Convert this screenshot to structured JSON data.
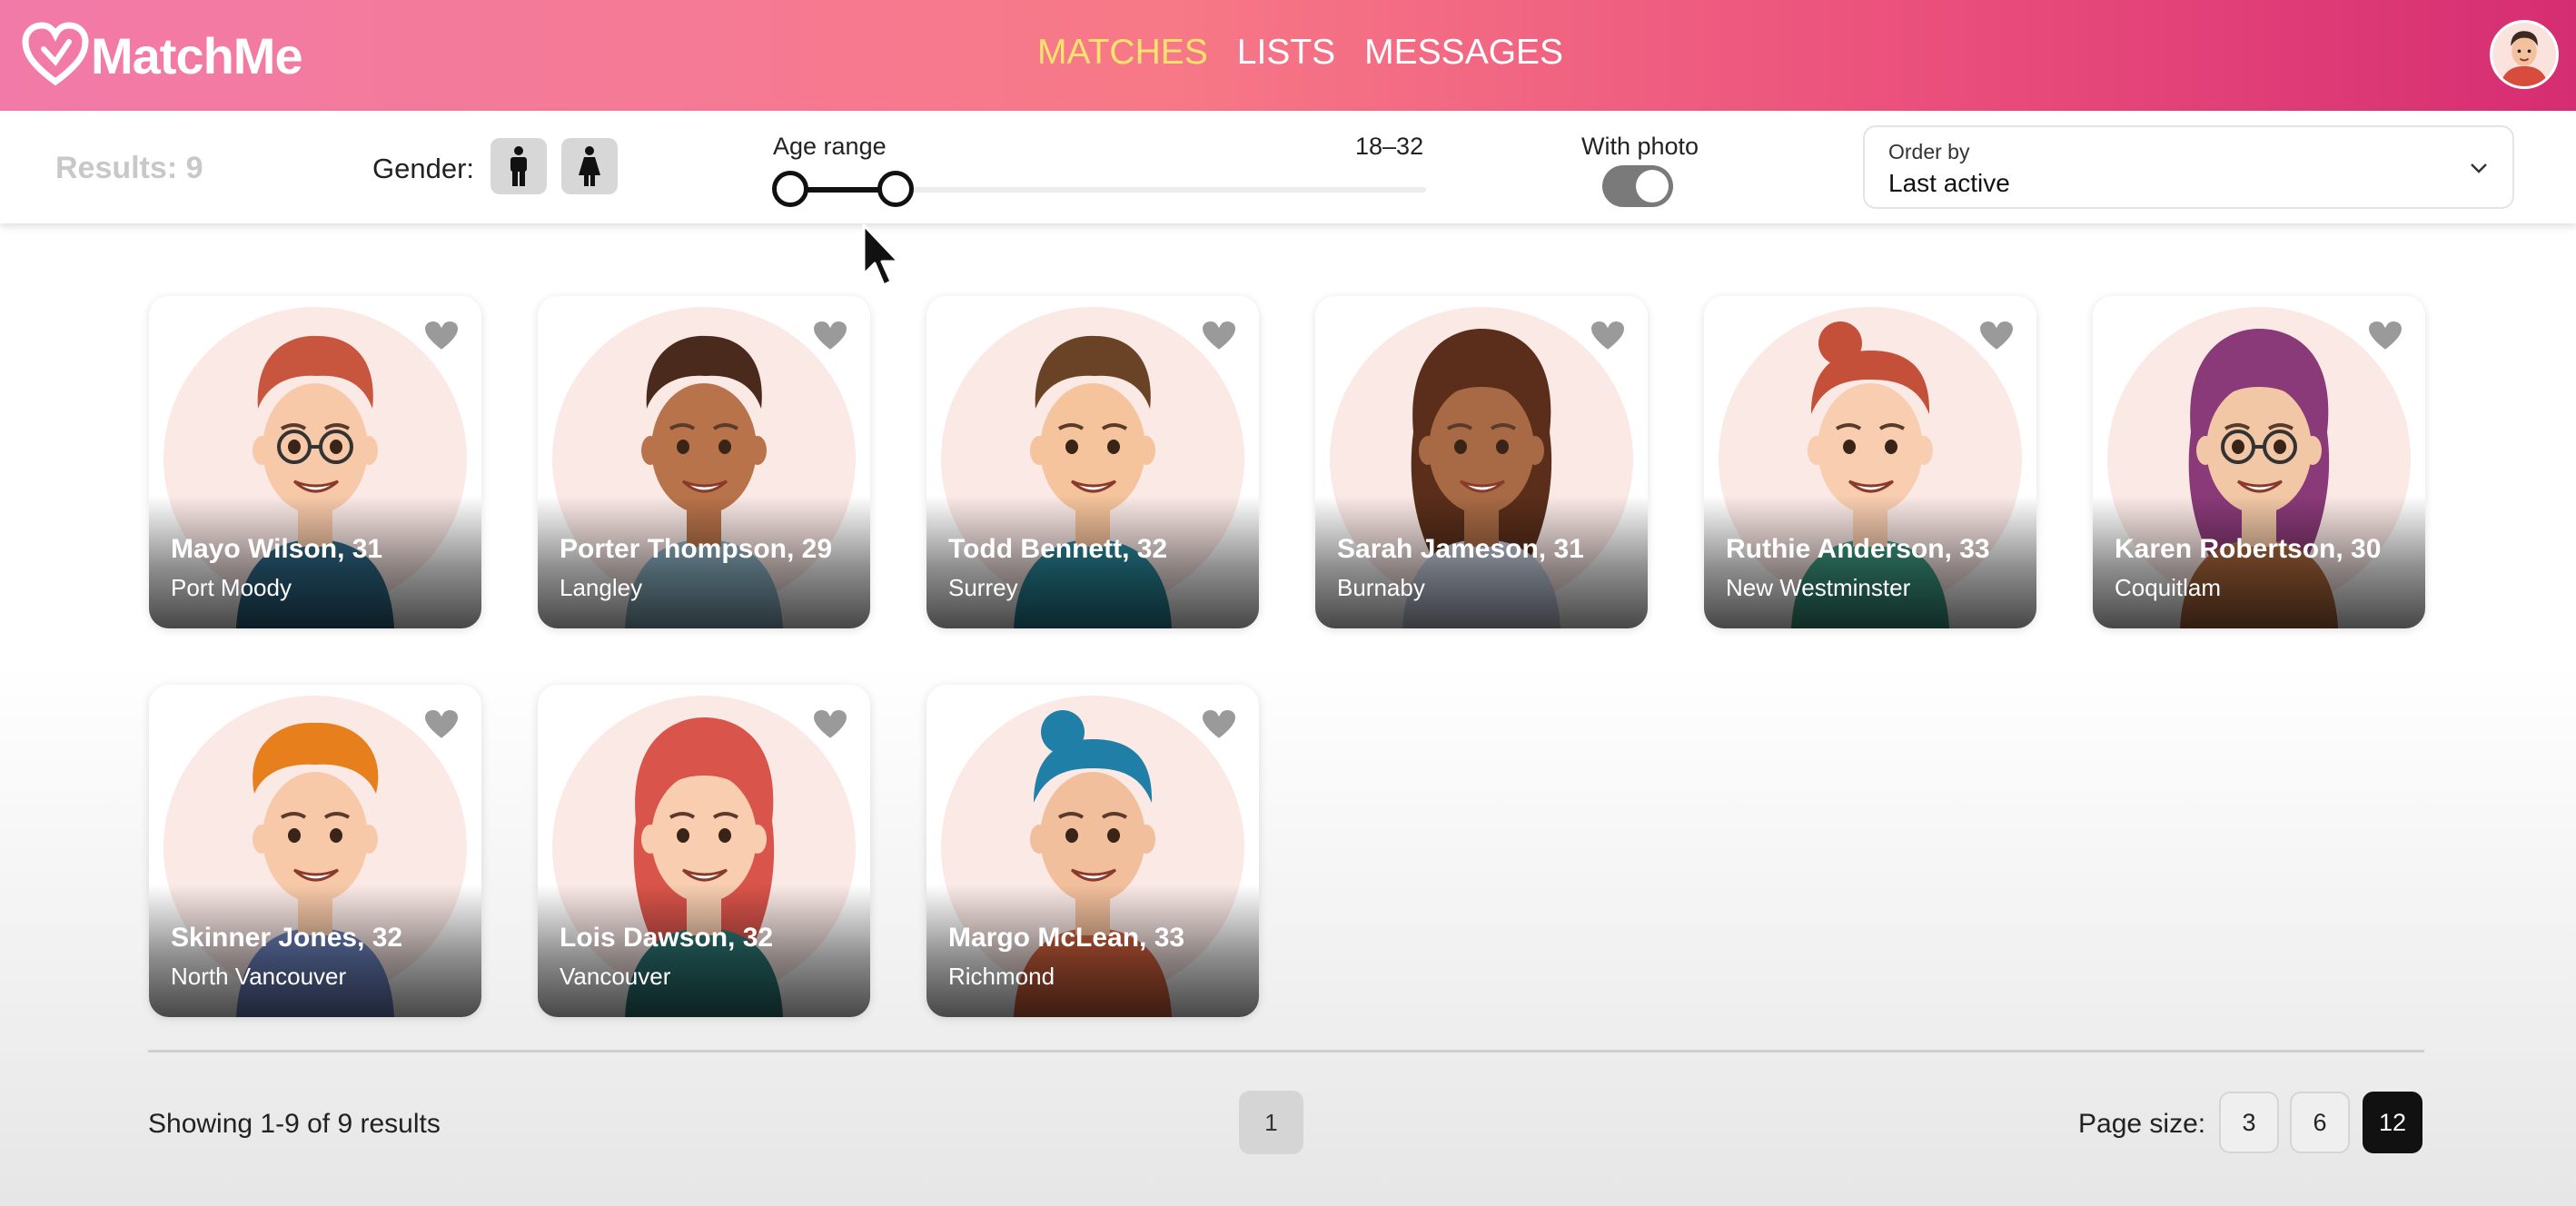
{
  "brand": {
    "name": "MatchMe"
  },
  "nav": {
    "links": [
      "MATCHES",
      "LISTS",
      "MESSAGES"
    ],
    "active": "MATCHES"
  },
  "filters": {
    "results": "Results: 9",
    "gender_label": "Gender:",
    "age_label": "Age range",
    "age_value": "18–32",
    "age_min": 18,
    "age_max": 32,
    "with_photo_label": "With photo",
    "with_photo": true,
    "order_caption": "Order by",
    "order_value": "Last active"
  },
  "members": [
    {
      "name": "Mayo Wilson, 31",
      "city": "Port Moody",
      "hair": "#c8553d",
      "skin": "#f7c9a8",
      "shirt": "#2f6b8a",
      "style": "short",
      "glasses": true
    },
    {
      "name": "Porter Thompson, 29",
      "city": "Langley",
      "hair": "#4a2a1c",
      "skin": "#b8734a",
      "shirt": "#8fb6c8",
      "style": "short",
      "glasses": false
    },
    {
      "name": "Todd Bennett, 32",
      "city": "Surrey",
      "hair": "#6a4326",
      "skin": "#f5c39c",
      "shirt": "#2a8a9e",
      "style": "short",
      "glasses": false
    },
    {
      "name": "Sarah Jameson, 31",
      "city": "Burnaby",
      "hair": "#5a2e1a",
      "skin": "#a86a45",
      "shirt": "#c7cfe0",
      "style": "long",
      "glasses": false
    },
    {
      "name": "Ruthie Anderson, 33",
      "city": "New Westminster",
      "hair": "#c4503a",
      "skin": "#f8cdb0",
      "shirt": "#3d9c84",
      "style": "bun",
      "glasses": false
    },
    {
      "name": "Karen Robertson, 30",
      "city": "Coquitlam",
      "hair": "#8a3a78",
      "skin": "#f2c7a6",
      "shirt": "#b06a3e",
      "style": "long",
      "glasses": true
    },
    {
      "name": "Skinner Jones, 32",
      "city": "North Vancouver",
      "hair": "#e67f1c",
      "skin": "#f7c9a8",
      "shirt": "#6f86c4",
      "style": "curly",
      "glasses": false
    },
    {
      "name": "Lois Dawson, 32",
      "city": "Vancouver",
      "hair": "#d9544a",
      "skin": "#f8cdb0",
      "shirt": "#2d7a78",
      "style": "long",
      "glasses": false
    },
    {
      "name": "Margo McLean, 33",
      "city": "Richmond",
      "hair": "#1f7fa6",
      "skin": "#f2bf9c",
      "shirt": "#d9643e",
      "style": "bun",
      "glasses": false
    }
  ],
  "footer": {
    "showing": "Showing 1-9 of 9 results",
    "page": "1",
    "page_size_label": "Page size:",
    "page_sizes": [
      "3",
      "6",
      "12"
    ],
    "page_size_active": "12"
  }
}
